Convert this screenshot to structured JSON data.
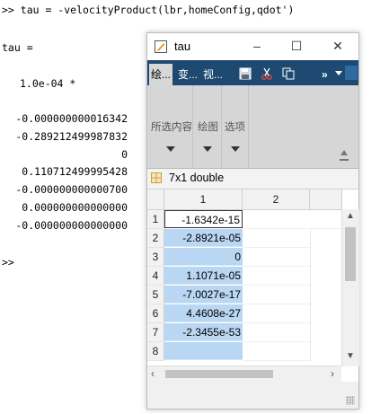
{
  "command_window": {
    "command": ">> tau = -velocityProduct(lbr,homeConfig,qdot')",
    "var_line": "tau =",
    "scale": "1.0e-04 *",
    "values": [
      "-0.000000000016342",
      "-0.289212499987832",
      "0",
      "0.110712499995428",
      "-0.000000000000700",
      "0.000000000000000",
      "-0.000000000000000"
    ],
    "prompt": ">>"
  },
  "variables_window": {
    "title": "tau",
    "controls": {
      "minimize": "–",
      "maximize": "☐",
      "close": "✕"
    },
    "tabs": [
      {
        "label": "绘...",
        "active": true
      },
      {
        "label": "变...",
        "active": false
      },
      {
        "label": "视...",
        "active": false
      }
    ],
    "toolbar_icons": [
      "save-icon",
      "cut-icon",
      "copy-icon"
    ],
    "overflow_label": "»",
    "ribbon": {
      "groups": [
        "所选内容",
        "绘图",
        "选项"
      ]
    },
    "variable_label": "7x1 double",
    "grid": {
      "columns": [
        "1",
        "2"
      ],
      "rows": [
        "1",
        "2",
        "3",
        "4",
        "5",
        "6",
        "7",
        "8"
      ],
      "values": [
        "-1.6342e-15",
        "-2.8921e-05",
        "0",
        "1.1071e-05",
        "-7.0027e-17",
        "4.4608e-27",
        "-2.3455e-53",
        ""
      ]
    },
    "scroll": {
      "up": "▲",
      "down": "▼",
      "left": "‹",
      "right": "›"
    },
    "colors": {
      "tab_bar": "#1e4a72",
      "selection": "#b9d6f2",
      "ribbon": "#d6d6d6"
    }
  }
}
